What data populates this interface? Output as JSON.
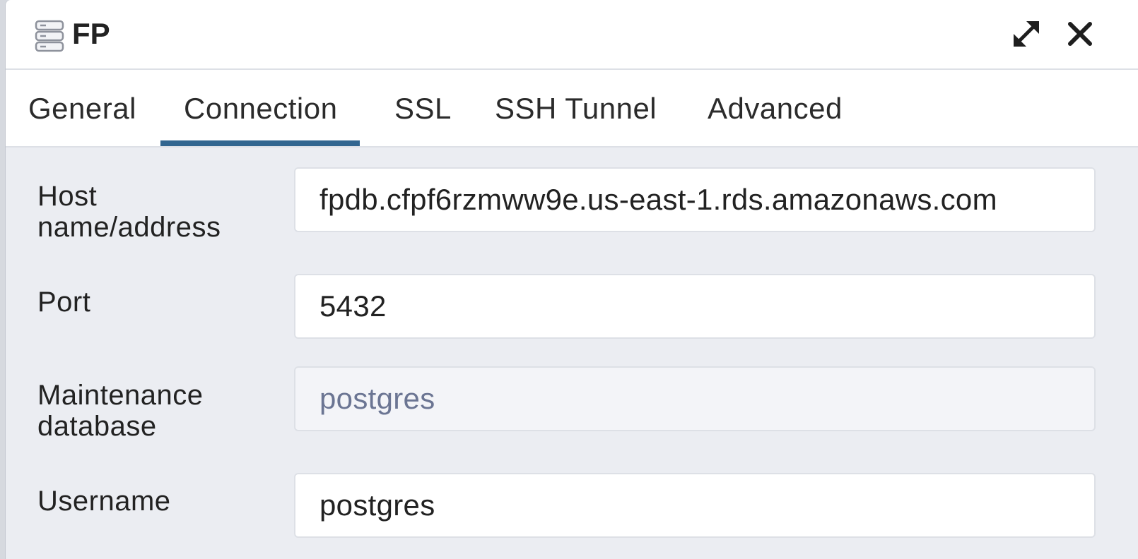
{
  "dialog": {
    "title": "FP",
    "icons": {
      "title_icon": "server-icon",
      "expand": "expand-icon",
      "close": "close-icon"
    }
  },
  "tabs": [
    {
      "label": "General",
      "active": false
    },
    {
      "label": "Connection",
      "active": true
    },
    {
      "label": "SSL",
      "active": false
    },
    {
      "label": "SSH Tunnel",
      "active": false
    },
    {
      "label": "Advanced",
      "active": false
    }
  ],
  "form": {
    "host": {
      "label_line1": "Host",
      "label_line2": "name/address",
      "value": "fpdb.cfpf6rzmww9e.us-east-1.rds.amazonaws.com"
    },
    "port": {
      "label": "Port",
      "value": "5432"
    },
    "maintenance_db": {
      "label_line1": "Maintenance",
      "label_line2": "database",
      "value": "postgres",
      "disabled": true
    },
    "username": {
      "label": "Username",
      "value": "postgres"
    }
  },
  "colors": {
    "accent": "#326690",
    "panel_bg": "#ebedf2",
    "disabled_text": "#6b7593"
  }
}
